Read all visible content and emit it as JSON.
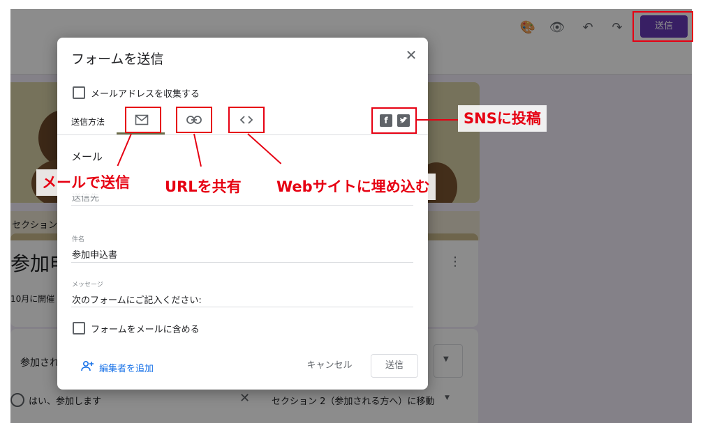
{
  "toolbar": {
    "icons": [
      "palette-icon",
      "eye-icon",
      "undo-icon",
      "redo-icon"
    ],
    "send_label": "送信"
  },
  "background_form": {
    "section_label": "セクション",
    "title_partial": "参加申",
    "description_partial": "10月に開催",
    "question_partial": "参加され",
    "option_label": "はい、参加します",
    "option_goto": "セクション 2（参加される方へ）に移動"
  },
  "dialog": {
    "title": "フォームを送信",
    "collect_email_label": "メールアドレスを収集する",
    "send_method_label": "送信方法",
    "tabs": [
      "mail-icon",
      "link-icon",
      "embed-code-icon"
    ],
    "social": [
      "facebook-icon",
      "twitter-icon"
    ],
    "mail_heading": "メール",
    "to_label": "送信先",
    "subject_label": "件名",
    "subject_value": "参加申込書",
    "message_label": "メッセージ",
    "message_value": "次のフォームにご記入ください:",
    "include_form_label": "フォームをメールに含める",
    "add_editor_label": "編集者を追加",
    "cancel_label": "キャンセル",
    "send_label": "送信"
  },
  "annotations": {
    "mail_send": "メールで送信",
    "url_share": "URLを共有",
    "web_embed": "Webサイトに埋め込む",
    "sns_post": "SNSに投稿"
  },
  "colors": {
    "accent": "#673ab7",
    "annotation_red": "#e60012",
    "link_blue": "#1a73e8"
  }
}
